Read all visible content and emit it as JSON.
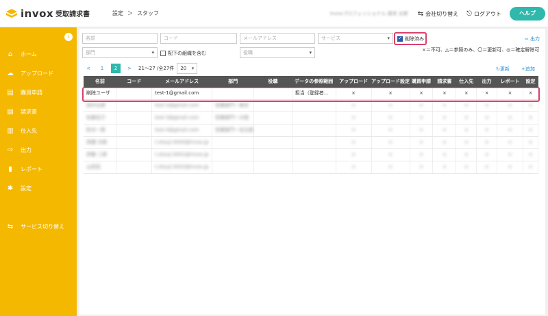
{
  "header": {
    "logo": "invox",
    "logo_sub": "受取請求書",
    "breadcrumb": [
      "設定",
      "＞",
      "スタッフ"
    ],
    "company": "invoxプロフェッショナル 請求 太郎",
    "switch_company": "会社切り替え",
    "logout": "ログアウト",
    "help": "ヘルプ"
  },
  "sidebar": {
    "items": [
      "ホーム",
      "アップロード",
      "購買申請",
      "請求書",
      "仕入先",
      "出力",
      "レポート",
      "設定",
      "サービス切り替え"
    ]
  },
  "filters": {
    "name": "名前",
    "code": "コード",
    "email": "メールアドレス",
    "service": "サービス",
    "deleted": "削除済み",
    "dept": "部門",
    "include_sub": "配下の組織を含む",
    "role": "役職",
    "output": "出力"
  },
  "legend": "×＝不可、△＝参照のみ、〇＝更新可、◎＝確定解除可",
  "pager": {
    "prev": "<",
    "page1": "1",
    "page2": "2",
    "next": ">",
    "range": "21〜27 /全27件",
    "per_page": "20",
    "refresh": "更新",
    "add": "追加"
  },
  "table": {
    "headers": [
      "名前",
      "コード",
      "メールアドレス",
      "部門",
      "役職",
      "データの参照範囲",
      "アップロード",
      "アップロード設定",
      "購買申請",
      "請求書",
      "仕入先",
      "出力",
      "レポート",
      "設定"
    ],
    "first_row": [
      "削除ユーザ",
      "",
      "test-1@gmail.com",
      "",
      "",
      "担当（登録者...",
      "×",
      "×",
      "",
      "×",
      "×",
      "×",
      "×",
      "×",
      "×"
    ],
    "blurred_rows": [
      [
        "田中太郎",
        "",
        "test-2@gmail.com",
        "営業部門ー東京",
        "",
        "",
        "×",
        "×",
        "",
        "×",
        "×",
        "×",
        "×",
        "×",
        "×"
      ],
      [
        "佐藤花子",
        "",
        "test-3@gmail.com",
        "営業部門ー大阪",
        "",
        "",
        "×",
        "×",
        "",
        "×",
        "×",
        "×",
        "×",
        "×",
        "×"
      ],
      [
        "鈴木一郎",
        "",
        "test-4@gmail.com",
        "営業部門ー名古屋",
        "",
        "",
        "×",
        "×",
        "",
        "×",
        "×",
        "×",
        "×",
        "×",
        "×"
      ],
      [
        "高橋 次郎",
        "",
        "t.otsuji.0000@invox.jp",
        "",
        "",
        "",
        "×",
        "×",
        "",
        "×",
        "×",
        "×",
        "×",
        "×",
        "×"
      ],
      [
        "伊藤 三郎",
        "",
        "t.otsuji.0001@invox.jp",
        "",
        "",
        "",
        "×",
        "×",
        "",
        "×",
        "×",
        "×",
        "×",
        "×",
        "×"
      ],
      [
        "山田花",
        "",
        "t.otsuji.0002@invox.jp",
        "",
        "",
        "",
        "×",
        "×",
        "",
        "×",
        "×",
        "×",
        "×",
        "×",
        "×"
      ]
    ]
  }
}
